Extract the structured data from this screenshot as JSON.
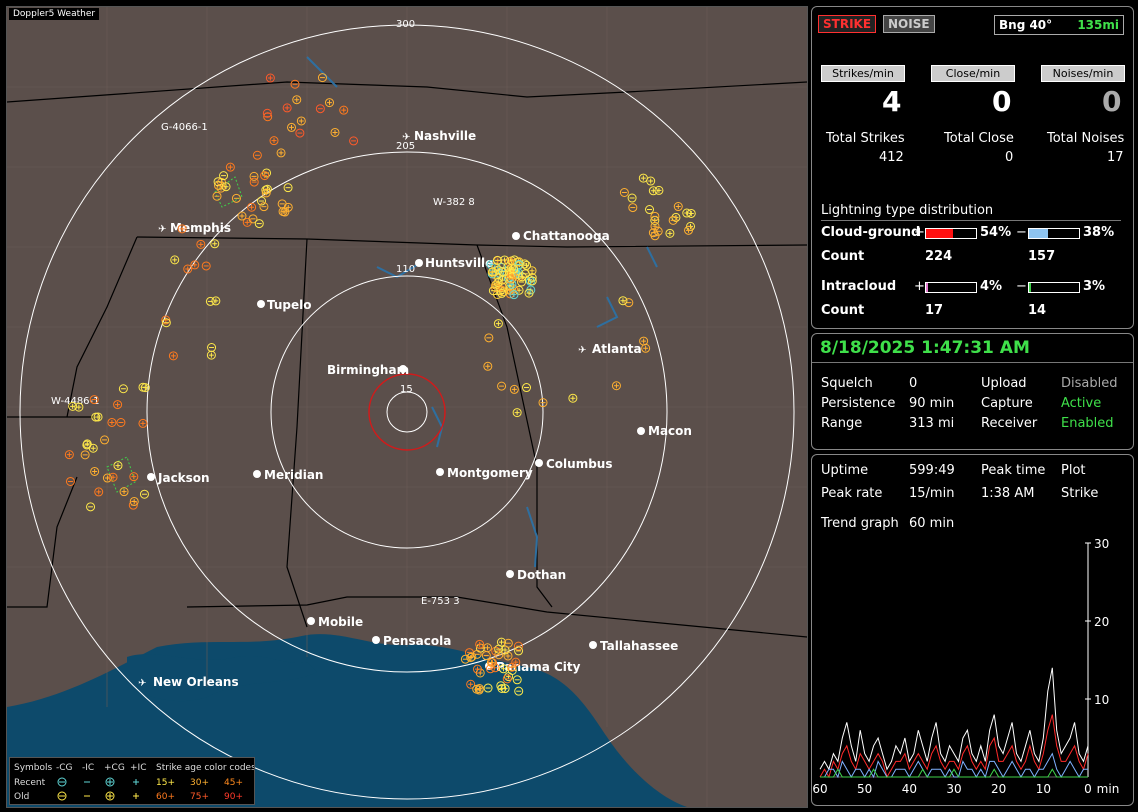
{
  "map": {
    "brand": "Doppler5 Weather",
    "range_labels": [
      "300",
      "205",
      "110",
      "15"
    ],
    "cities": [
      {
        "name": "Nashville"
      },
      {
        "name": "Memphis"
      },
      {
        "name": "Huntsville"
      },
      {
        "name": "Chattanooga"
      },
      {
        "name": "Tupelo"
      },
      {
        "name": "Atlanta"
      },
      {
        "name": "Birmingham"
      },
      {
        "name": "Macon"
      },
      {
        "name": "Jackson"
      },
      {
        "name": "Meridian"
      },
      {
        "name": "Montgomery"
      },
      {
        "name": "Columbus"
      },
      {
        "name": "Dothan"
      },
      {
        "name": "Mobile"
      },
      {
        "name": "Pensacola"
      },
      {
        "name": "Tallahassee"
      },
      {
        "name": "Panama City"
      },
      {
        "name": "New Orleans"
      }
    ],
    "storm_ids": [
      "G-4066-1",
      "W-382 8",
      "W-4486-1",
      "E-753 3"
    ],
    "legend": {
      "symbols_title": "Symbols",
      "cols": [
        "-CG",
        "-IC",
        "+CG",
        "+IC"
      ],
      "recent_label": "Recent",
      "old_label": "Old",
      "age_title": "Strike age color codes",
      "recent_ages": [
        "15+",
        "30+",
        "45+"
      ],
      "old_ages": [
        "60+",
        "75+",
        "90+"
      ]
    }
  },
  "top": {
    "strike_btn": "STRIKE",
    "noise_btn": "NOISE",
    "bearing": "Bng 40°",
    "distance": "135mi",
    "strikes_min_label": "Strikes/min",
    "close_min_label": "Close/min",
    "noises_min_label": "Noises/min",
    "strikes_min": "4",
    "close_min": "0",
    "noises_min": "0",
    "total_strikes_label": "Total Strikes",
    "total_close_label": "Total Close",
    "total_noises_label": "Total Noises",
    "total_strikes": "412",
    "total_close": "0",
    "total_noises": "17",
    "dist_title": "Lightning type distribution",
    "cg_label": "Cloud-ground",
    "ic_label": "Intracloud",
    "count_label": "Count",
    "plus": "+",
    "minus": "−",
    "cg_pos_pct": "54%",
    "cg_neg_pct": "38%",
    "cg_pos_count": "224",
    "cg_neg_count": "157",
    "ic_pos_pct": "4%",
    "ic_neg_pct": "3%",
    "ic_pos_count": "17",
    "ic_neg_count": "14",
    "cg_pos_frac": 0.54,
    "cg_neg_frac": 0.38,
    "ic_pos_frac": 0.04,
    "ic_neg_frac": 0.03
  },
  "status": {
    "datetime": "8/18/2025 1:47:31 AM",
    "squelch_label": "Squelch",
    "squelch": "0",
    "persistence_label": "Persistence",
    "persistence": "90 min",
    "range_label": "Range",
    "range": "313 mi",
    "upload_label": "Upload",
    "upload": "Disabled",
    "capture_label": "Capture",
    "capture": "Active",
    "receiver_label": "Receiver",
    "receiver": "Enabled"
  },
  "stats": {
    "uptime_label": "Uptime",
    "uptime": "599:49",
    "peak_time_label": "Peak time",
    "peak_time": "1:38 AM",
    "plot_label": "Plot",
    "plot": "Strike",
    "peak_rate_label": "Peak rate",
    "peak_rate": "15/min",
    "trend_label": "Trend graph",
    "trend": "60 min"
  },
  "chart_data": {
    "type": "line",
    "xlabel": "min",
    "x_ticks": [
      "60",
      "50",
      "40",
      "30",
      "20",
      "10",
      "0"
    ],
    "y_ticks": [
      "30",
      "20",
      "10"
    ],
    "xlim": [
      60,
      0
    ],
    "ylim": [
      0,
      30
    ],
    "series": [
      {
        "color": "#ffffff",
        "values": [
          1,
          2,
          1,
          3,
          2,
          5,
          7,
          4,
          2,
          6,
          3,
          2,
          4,
          5,
          3,
          1,
          2,
          4,
          3,
          5,
          2,
          3,
          6,
          4,
          2,
          5,
          7,
          3,
          2,
          4,
          3,
          2,
          5,
          6,
          3,
          2,
          4,
          2,
          6,
          8,
          4,
          3,
          5,
          7,
          3,
          2,
          4,
          6,
          3,
          2,
          5,
          11,
          14,
          6,
          3,
          4,
          5,
          7,
          3,
          2,
          4
        ]
      },
      {
        "color": "#ff2a2a",
        "values": [
          0,
          1,
          0,
          2,
          1,
          3,
          4,
          2,
          1,
          3,
          2,
          1,
          2,
          3,
          2,
          0,
          1,
          2,
          2,
          3,
          1,
          2,
          3,
          2,
          1,
          3,
          4,
          2,
          1,
          2,
          2,
          1,
          3,
          4,
          2,
          1,
          2,
          1,
          4,
          5,
          2,
          2,
          3,
          4,
          2,
          1,
          2,
          4,
          2,
          1,
          3,
          6,
          8,
          4,
          2,
          2,
          3,
          4,
          2,
          1,
          3
        ]
      },
      {
        "color": "#7fb2ff",
        "values": [
          0,
          0,
          1,
          1,
          0,
          2,
          1,
          0,
          1,
          1,
          0,
          1,
          0,
          2,
          1,
          0,
          0,
          1,
          1,
          1,
          0,
          1,
          2,
          1,
          0,
          1,
          1,
          1,
          0,
          1,
          0,
          0,
          2,
          1,
          1,
          0,
          1,
          0,
          2,
          2,
          1,
          0,
          1,
          2,
          1,
          0,
          1,
          1,
          0,
          1,
          1,
          2,
          3,
          1,
          0,
          1,
          2,
          1,
          0,
          1,
          1
        ]
      },
      {
        "color": "#3fd24a",
        "values": [
          0,
          0,
          0,
          0,
          1,
          0,
          0,
          0,
          0,
          0,
          0,
          0,
          1,
          0,
          0,
          0,
          0,
          0,
          0,
          0,
          0,
          0,
          0,
          1,
          0,
          0,
          0,
          0,
          0,
          0,
          1,
          0,
          0,
          0,
          0,
          0,
          0,
          0,
          0,
          1,
          0,
          0,
          0,
          0,
          0,
          0,
          0,
          0,
          0,
          0,
          0,
          0,
          1,
          0,
          0,
          0,
          0,
          0,
          0,
          0,
          0
        ]
      }
    ]
  }
}
